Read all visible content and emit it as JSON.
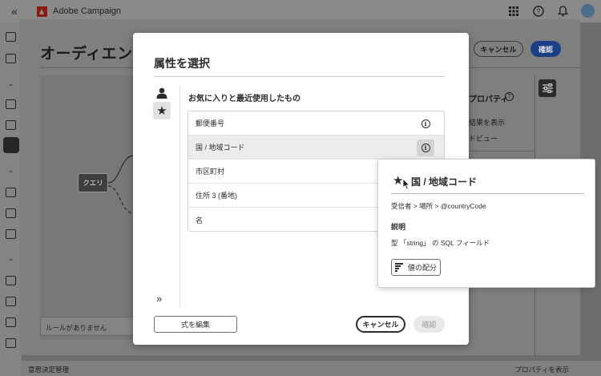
{
  "topbar": {
    "app_name": "Adobe Campaign"
  },
  "workspace": {
    "title": "オーディエンス",
    "cancel_label": "キャンセル",
    "confirm_label": "確認",
    "query_node_label": "クエリ",
    "rules_empty": "ルールがありません",
    "properties_title": "プロパティ",
    "properties_line1": "結果を表示",
    "properties_line2": "ドビュー"
  },
  "statusbar": {
    "left": "意思決定管理",
    "right": "プロパティを表示"
  },
  "dialog": {
    "title": "属性を選択",
    "section_title": "お気に入りと最近使用したもの",
    "attributes": [
      {
        "label": "郵便番号"
      },
      {
        "label": "国 / 地域コード"
      },
      {
        "label": "市区町村"
      },
      {
        "label": "住所 3 (番地)"
      },
      {
        "label": "名"
      }
    ],
    "expand_glyph": "»",
    "edit_expression_label": "式を編集",
    "cancel_label": "キャンセル",
    "confirm_label": "確認"
  },
  "popover": {
    "title": "国 / 地域コード",
    "path": "受信者 > 場所 > @countryCode",
    "description_heading": "説明",
    "description": "型 「string」 の SQL フィールド",
    "distribution_label": "値の配分"
  },
  "icons": {
    "info_glyph": "i",
    "star_glyph": "★"
  },
  "colors": {
    "primary_button": "#1a3f86",
    "brand": "#8c1a10"
  }
}
